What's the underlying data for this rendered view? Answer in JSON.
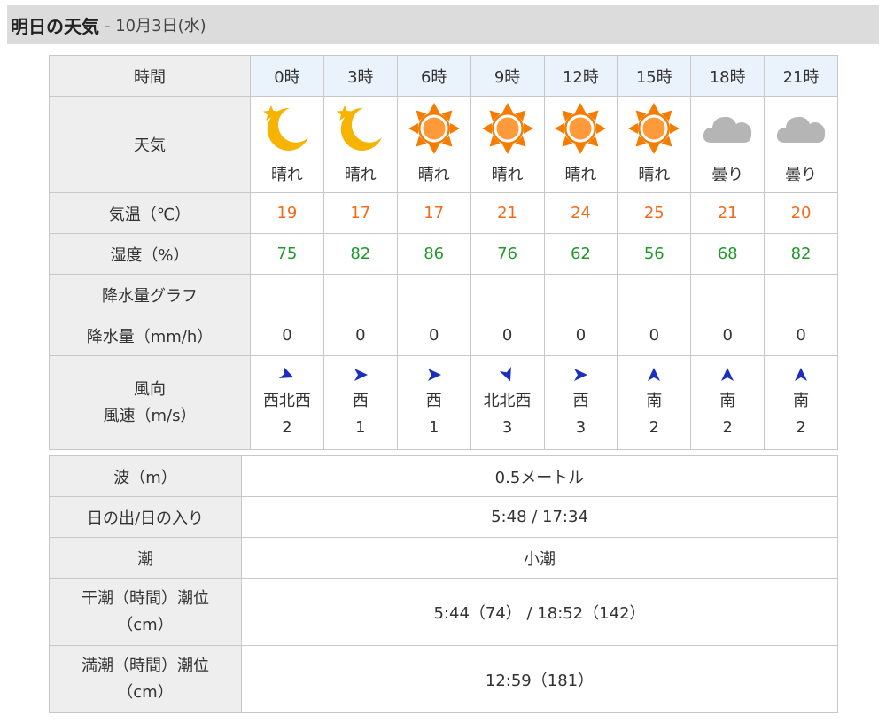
{
  "header": {
    "title": "明日の天気",
    "date": "- 10月3日(水)"
  },
  "forecast": {
    "labels": {
      "time": "時間",
      "weather": "天気",
      "temp": "気温（℃）",
      "humidity": "湿度（%）",
      "rain_graph": "降水量グラフ",
      "rain": "降水量（mm/h）",
      "wind_dir": "風向",
      "wind_speed": "風速（m/s）"
    },
    "columns": [
      {
        "time": "0時",
        "icon": "moon-star-icon",
        "weather": "晴れ",
        "temp": "19",
        "humidity": "75",
        "rain": "0",
        "wind_dir": "西北西",
        "wind_speed": "2",
        "arrow_deg": 22
      },
      {
        "time": "3時",
        "icon": "moon-star-icon",
        "weather": "晴れ",
        "temp": "17",
        "humidity": "82",
        "rain": "0",
        "wind_dir": "西",
        "wind_speed": "1",
        "arrow_deg": 0
      },
      {
        "time": "6時",
        "icon": "sun-icon",
        "weather": "晴れ",
        "temp": "17",
        "humidity": "86",
        "rain": "0",
        "wind_dir": "西",
        "wind_speed": "1",
        "arrow_deg": 0
      },
      {
        "time": "9時",
        "icon": "sun-icon",
        "weather": "晴れ",
        "temp": "21",
        "humidity": "76",
        "rain": "0",
        "wind_dir": "北北西",
        "wind_speed": "3",
        "arrow_deg": 68
      },
      {
        "time": "12時",
        "icon": "sun-icon",
        "weather": "晴れ",
        "temp": "24",
        "humidity": "62",
        "rain": "0",
        "wind_dir": "西",
        "wind_speed": "3",
        "arrow_deg": 0
      },
      {
        "time": "15時",
        "icon": "sun-icon",
        "weather": "晴れ",
        "temp": "25",
        "humidity": "56",
        "rain": "0",
        "wind_dir": "南",
        "wind_speed": "2",
        "arrow_deg": -90
      },
      {
        "time": "18時",
        "icon": "cloud-icon",
        "weather": "曇り",
        "temp": "21",
        "humidity": "68",
        "rain": "0",
        "wind_dir": "南",
        "wind_speed": "2",
        "arrow_deg": -90
      },
      {
        "time": "21時",
        "icon": "cloud-icon",
        "weather": "曇り",
        "temp": "20",
        "humidity": "82",
        "rain": "0",
        "wind_dir": "南",
        "wind_speed": "2",
        "arrow_deg": -90
      }
    ]
  },
  "tide": {
    "rows": [
      {
        "label": "波（m）",
        "value": "0.5メートル"
      },
      {
        "label": "日の出/日の入り",
        "value": "5:48 / 17:34"
      },
      {
        "label": "潮",
        "value": "小潮"
      },
      {
        "label": "干潮（時間）潮位（cm）",
        "value": "5:44（74） / 18:52（142）"
      },
      {
        "label": "満潮（時間）潮位（cm）",
        "value": "12:59（181）"
      }
    ]
  },
  "colors": {
    "header_bg": "#dcdcdc",
    "label_bg": "#eeeeee",
    "time_header_bg": "#eaf2fb",
    "temp": "#f26b1d",
    "humidity": "#1f9a2a",
    "sun": "#f57c00",
    "moon": "#f6b400",
    "cloud": "#b5b5b5",
    "arrow": "#1a2fbf"
  }
}
